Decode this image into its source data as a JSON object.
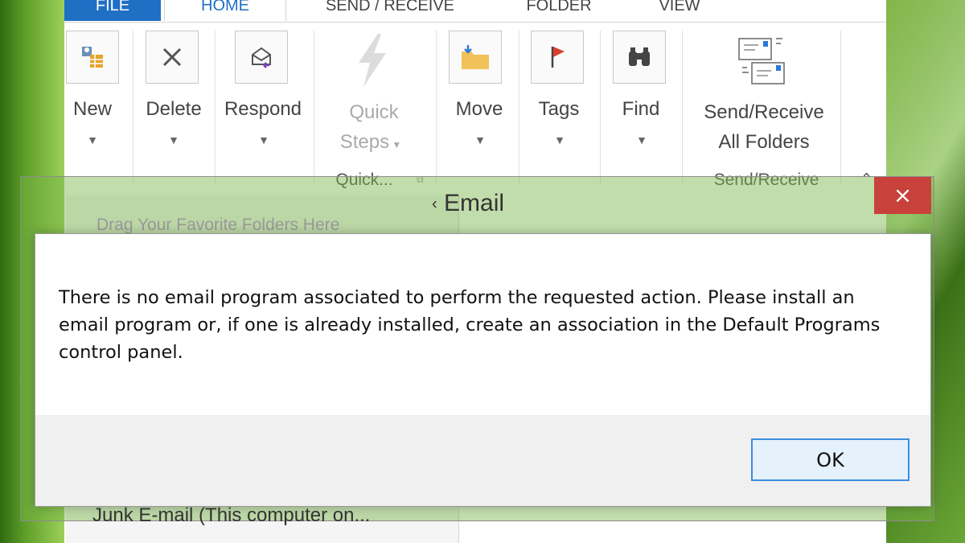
{
  "tabs": {
    "file": "FILE",
    "home": "HOME",
    "send_receive": "SEND / RECEIVE",
    "folder": "FOLDER",
    "view": "VIEW"
  },
  "ribbon": {
    "new": "New",
    "delete": "Delete",
    "respond": "Respond",
    "quick_steps_line1": "Quick",
    "quick_steps_line2": "Steps",
    "quick_steps_group": "Quick...",
    "move": "Move",
    "tags": "Tags",
    "find": "Find",
    "send_receive_line1": "Send/Receive",
    "send_receive_line2": "All Folders",
    "send_receive_group": "Send/Receive"
  },
  "email_window": {
    "title": "Email",
    "close_icon": "×",
    "favorites_hint": "Drag Your Favorite Folders Here",
    "junk_folder": "Junk E-mail (This computer on..."
  },
  "dialog": {
    "message": "There is no email program associated to perform the requested action. Please install an email program or, if one is already installed, create an association in the Default Programs control panel.",
    "ok_label": "OK"
  },
  "colors": {
    "accent": "#1f6fc5",
    "close_red": "#c8413b",
    "ok_border": "#3c8de0"
  }
}
